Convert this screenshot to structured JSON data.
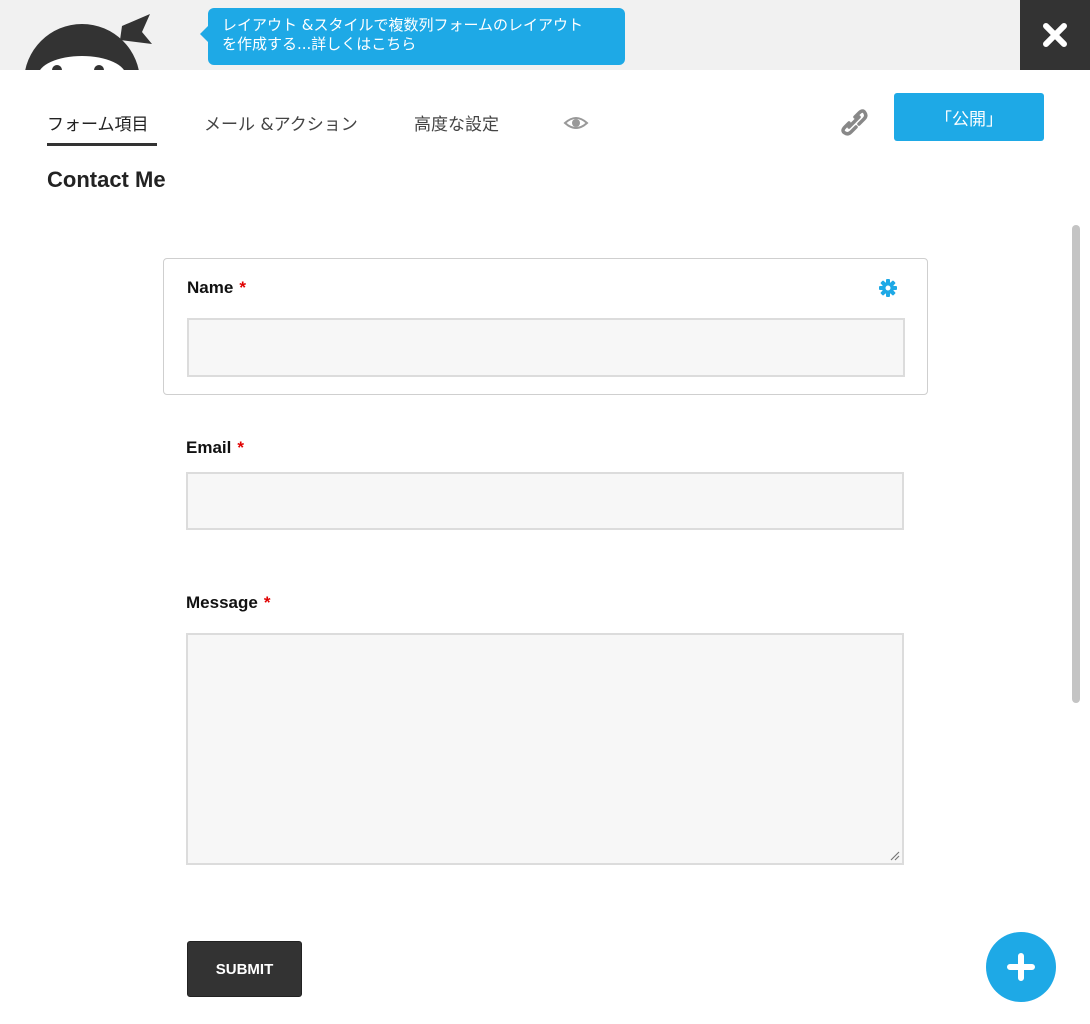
{
  "header": {
    "tooltip_line1": "レイアウト &スタイルで複数列フォームのレイアウト",
    "tooltip_line2": "を作成する...詳しくはこちら",
    "logo_icon": "ninja-logo",
    "close_icon": "close-x-icon"
  },
  "tabs": [
    {
      "label": "フォーム項目",
      "active": true
    },
    {
      "label": "メール &アクション",
      "active": false
    },
    {
      "label": "高度な設定",
      "active": false
    }
  ],
  "toolbar": {
    "preview_icon": "eye-icon",
    "link_icon": "link-icon",
    "publish_label": "「公開」"
  },
  "form": {
    "title": "Contact Me",
    "fields": [
      {
        "label": "Name",
        "required_mark": "*",
        "type": "text",
        "selected": true
      },
      {
        "label": "Email",
        "required_mark": "*",
        "type": "text"
      },
      {
        "label": "Message",
        "required_mark": "*",
        "type": "textarea"
      }
    ],
    "submit_label": "SUBMIT"
  },
  "fab_icon": "plus-icon",
  "colors": {
    "accent": "#1ea9e6",
    "dark": "#333333",
    "required": "#e00000"
  }
}
